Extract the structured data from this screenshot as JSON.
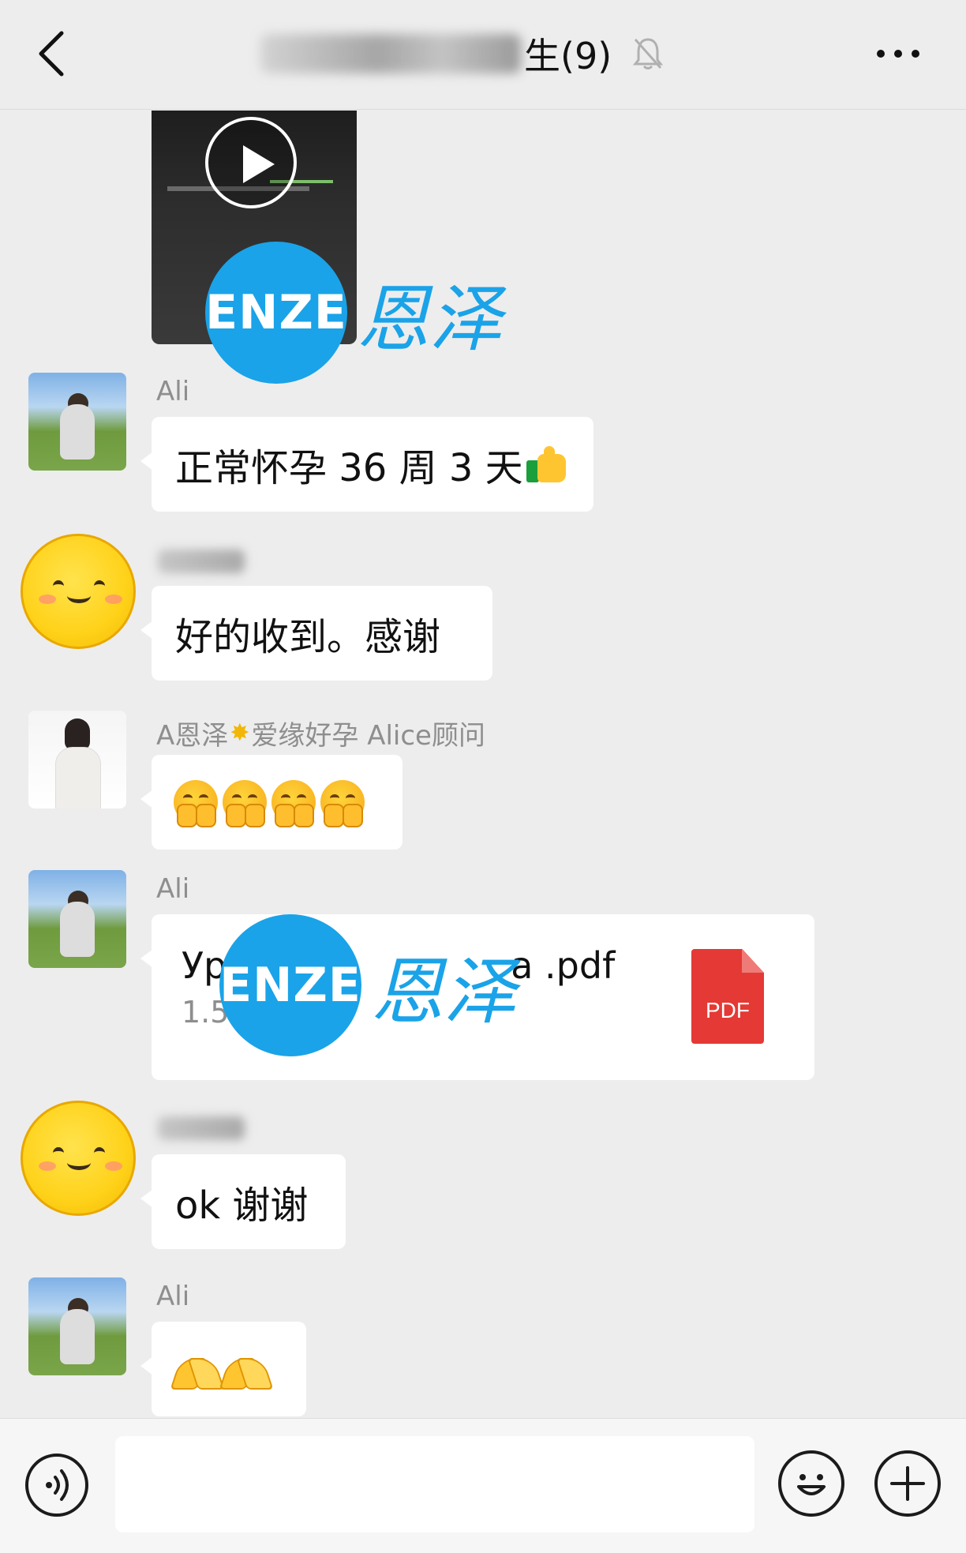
{
  "header": {
    "title_visible": "生(9)",
    "title_prefix_blurred": true
  },
  "watermark": {
    "logo_text": "ENZE",
    "text": "恩泽",
    "color": "#1aa3e8"
  },
  "messages": [
    {
      "type": "video",
      "play_icon": "play-icon"
    },
    {
      "type": "text",
      "sender": "Ali",
      "text": "正常怀孕 36 周 3 天",
      "trailing_emoji": "thumbs-up-icon"
    },
    {
      "type": "text",
      "sender_blurred": true,
      "text": "好的收到。感谢"
    },
    {
      "type": "emoji",
      "sender_prefix": "A恩泽",
      "sender_suffix": "爱缘好孕 Alice顾问",
      "sender_emoji": "sparkle-icon",
      "emoji": "shushing-face-icon",
      "count": 4
    },
    {
      "type": "file",
      "sender": "Ali",
      "file_name": "Ур",
      "file_name_tail": "а .pdf",
      "file_size": "1.5",
      "file_icon_label": "PDF"
    },
    {
      "type": "text",
      "sender_blurred": true,
      "text": "ok 谢谢"
    },
    {
      "type": "emoji",
      "sender": "Ali",
      "emoji": "pray-icon",
      "count": 2
    }
  ],
  "input_bar": {
    "placeholder": ""
  },
  "colors": {
    "background": "#ededed",
    "bubble": "#ffffff",
    "accent_watermark": "#1aa3e8",
    "pdf_red": "#e53935"
  }
}
